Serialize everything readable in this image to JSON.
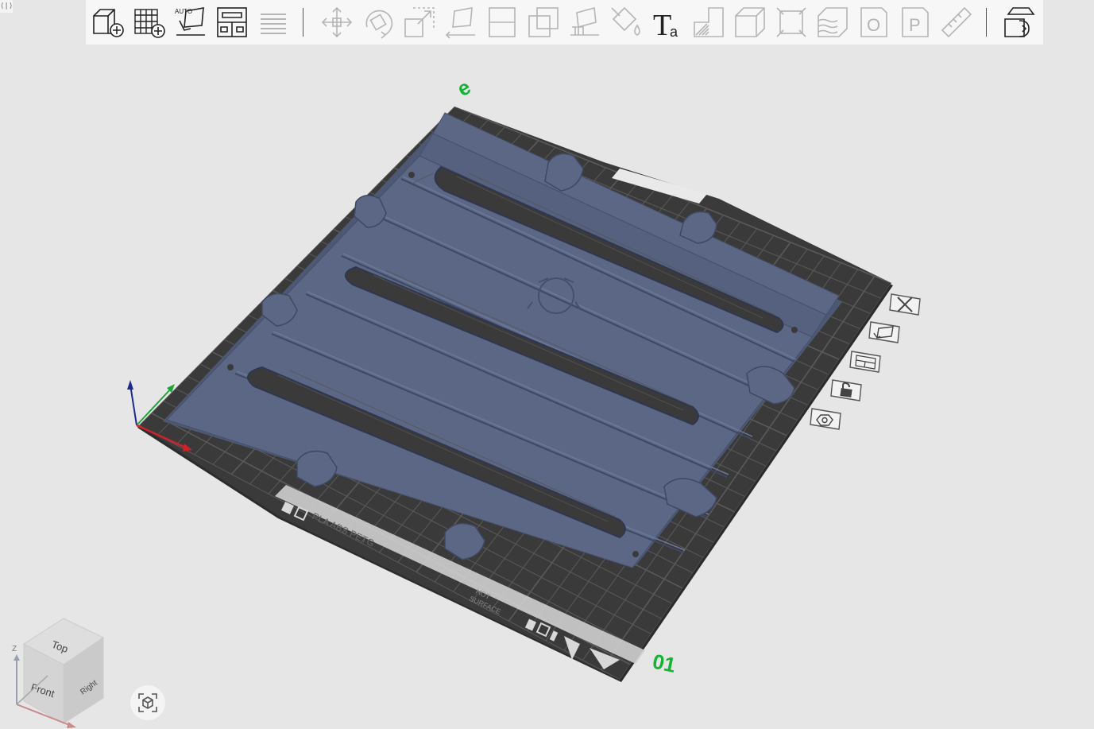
{
  "window": {
    "collapse_handle": "⟨|⟩"
  },
  "toolbar": {
    "buttons": [
      {
        "name": "add-object-icon",
        "enabled": true
      },
      {
        "name": "add-plate-icon",
        "enabled": true
      },
      {
        "name": "auto-orient-icon",
        "enabled": true,
        "badge": "AUTO"
      },
      {
        "name": "arrange-icon",
        "enabled": true
      },
      {
        "name": "split-layers-icon",
        "enabled": false
      },
      {
        "name": "move-icon",
        "enabled": false
      },
      {
        "name": "rotate-icon",
        "enabled": false
      },
      {
        "name": "scale-icon",
        "enabled": false
      },
      {
        "name": "lay-on-face-icon",
        "enabled": false
      },
      {
        "name": "cut-icon",
        "enabled": false
      },
      {
        "name": "boolean-icon",
        "enabled": false
      },
      {
        "name": "support-paint-icon",
        "enabled": false
      },
      {
        "name": "color-paint-icon",
        "enabled": false
      },
      {
        "name": "text-tool-icon",
        "enabled": true,
        "glyph_main": "T",
        "glyph_sub": "a"
      },
      {
        "name": "seam-paint-icon",
        "enabled": false
      },
      {
        "name": "variable-height-icon",
        "enabled": false
      },
      {
        "name": "simplify-icon",
        "enabled": false
      },
      {
        "name": "fuzzy-skin-icon",
        "enabled": false
      },
      {
        "name": "object-view-icon",
        "enabled": false,
        "glyph": "O"
      },
      {
        "name": "part-view-icon",
        "enabled": false,
        "glyph": "P"
      },
      {
        "name": "measure-icon",
        "enabled": false
      },
      {
        "name": "assembly-view-icon",
        "enabled": true
      }
    ]
  },
  "plate": {
    "number_label": "01",
    "filament_label": "PLA ABS PETG",
    "surface_label_line1": "HOT",
    "surface_label_line2": "SURFACE",
    "top_marker": "e"
  },
  "plate_controls": [
    {
      "name": "delete-plate-icon"
    },
    {
      "name": "orient-plate-icon"
    },
    {
      "name": "arrange-plate-icon"
    },
    {
      "name": "lock-plate-icon"
    },
    {
      "name": "plate-settings-icon"
    }
  ],
  "view_cube": {
    "top": "Top",
    "front": "Front",
    "right": "Right",
    "z_axis": "Z"
  },
  "colors": {
    "background": "#e6e6e6",
    "toolbar": "#f7f7f7",
    "bed": "#3a3a3a",
    "grid": "#5a5a5a",
    "model": "#5b6785",
    "plate_label": "#16b233",
    "axis_x": "#d0202a",
    "axis_y": "#1fa63a",
    "axis_z": "#1b2a8f"
  }
}
